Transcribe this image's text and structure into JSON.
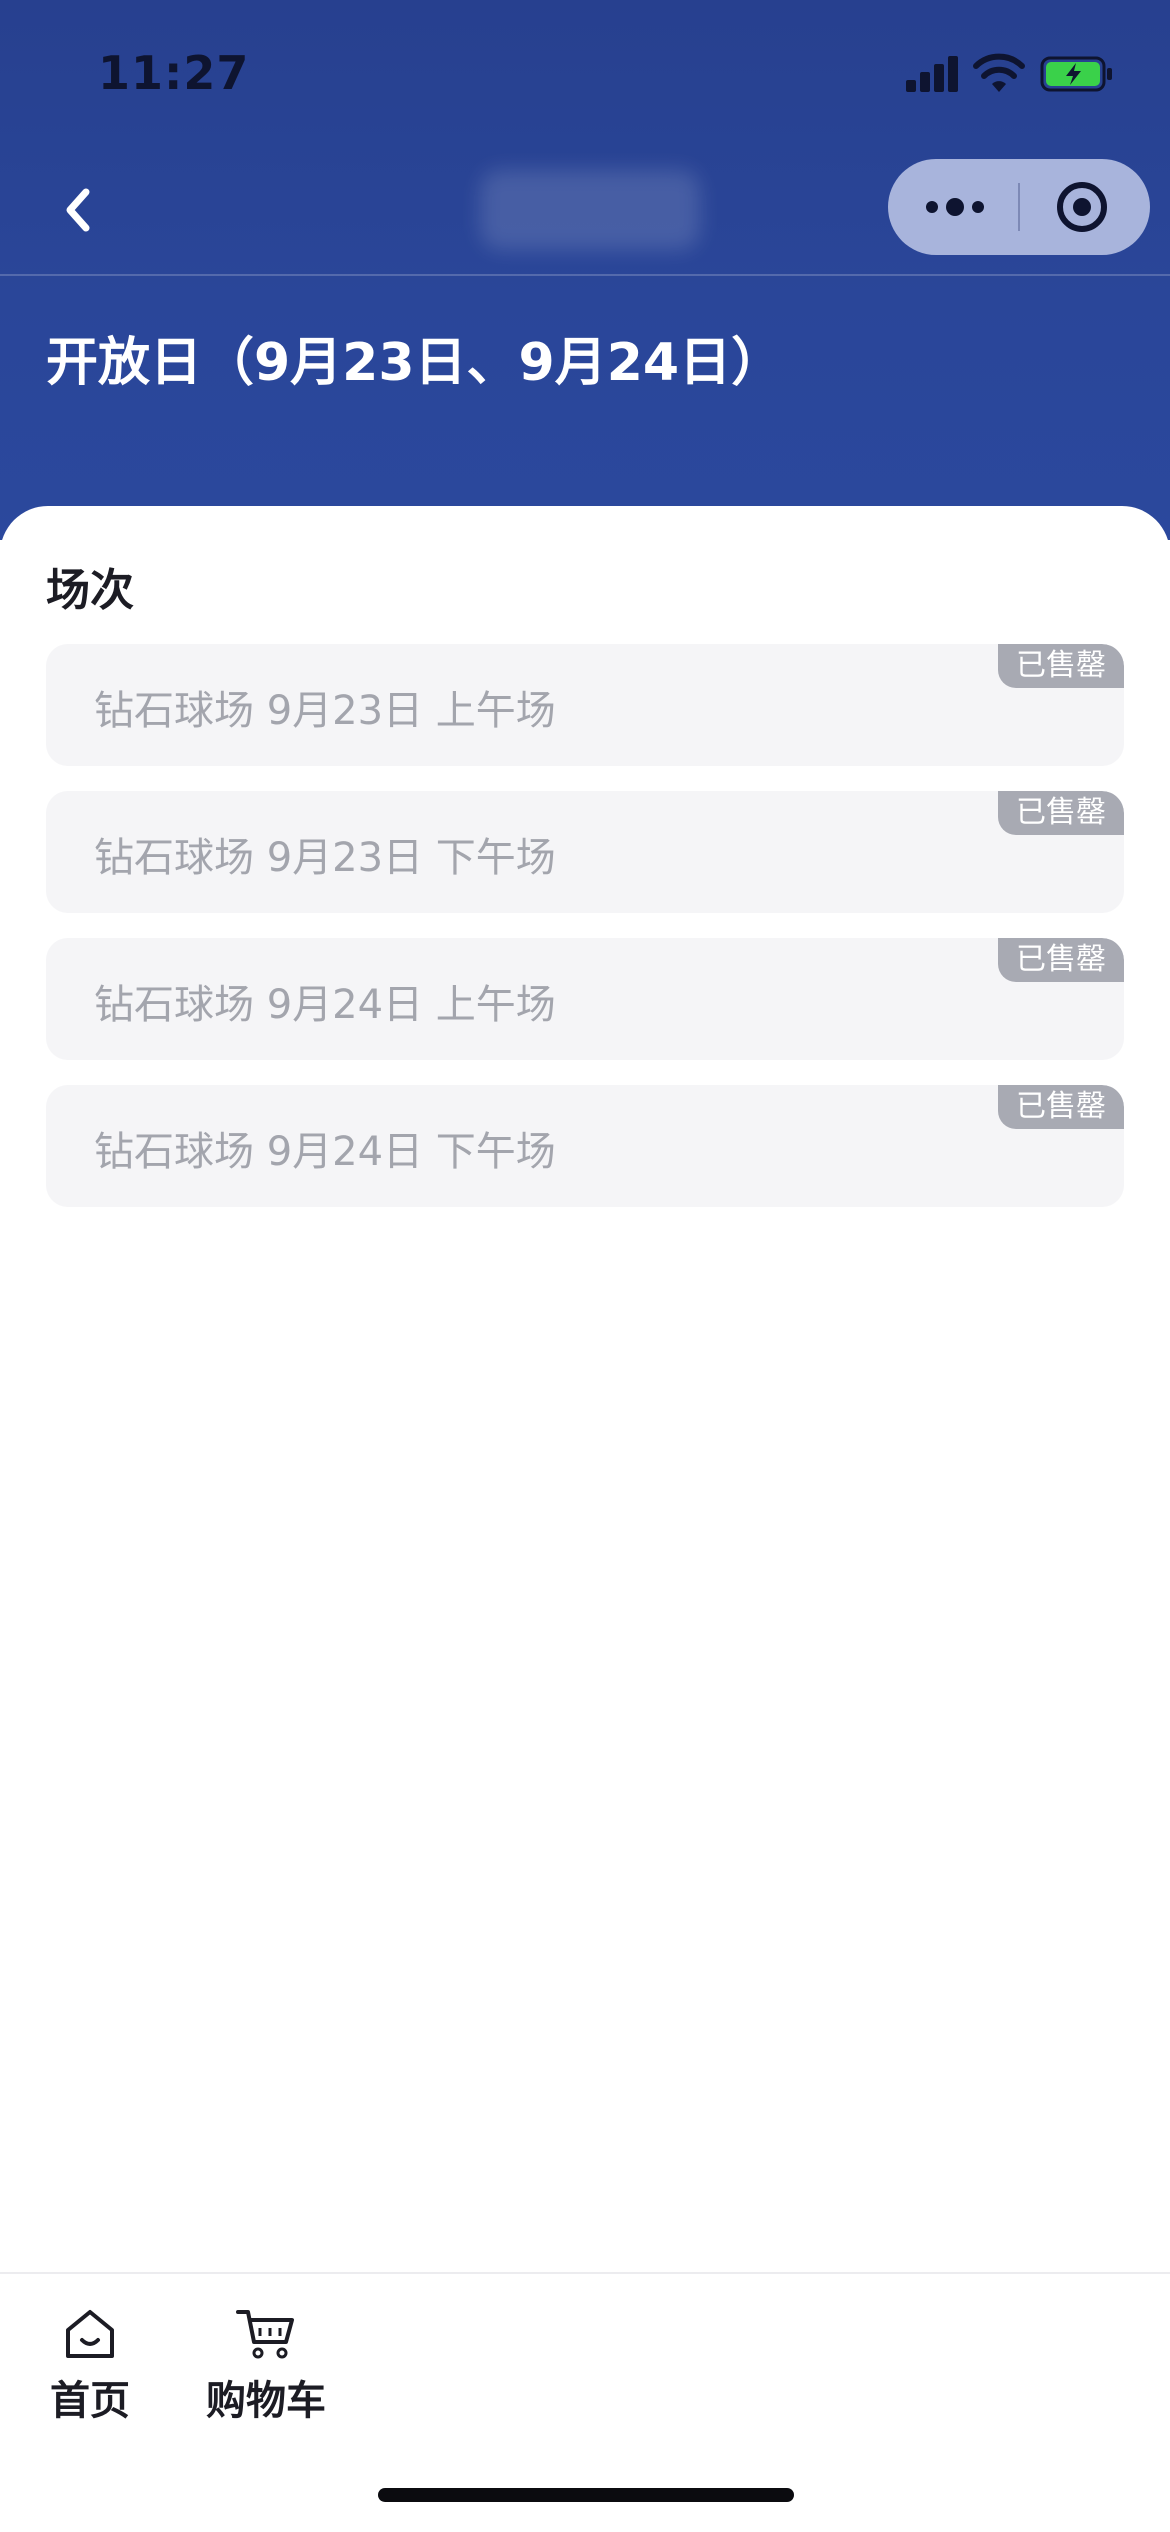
{
  "status_bar": {
    "time": "11:27",
    "signal_icon": "cellular-signal-icon",
    "wifi_icon": "wifi-icon",
    "battery_icon": "battery-charging-icon"
  },
  "nav": {
    "back_icon": "chevron-left-icon",
    "more_icon": "more-dots-icon",
    "close_icon": "target-circle-icon"
  },
  "page_title": "开放日（9月23日、9月24日）",
  "section_title": "场次",
  "sessions": [
    {
      "label": "钻石球场 9月23日 上午场",
      "badge": "已售罄"
    },
    {
      "label": "钻石球场 9月23日 下午场",
      "badge": "已售罄"
    },
    {
      "label": "钻石球场 9月24日 上午场",
      "badge": "已售罄"
    },
    {
      "label": "钻石球场 9月24日 下午场",
      "badge": "已售罄"
    }
  ],
  "tab_bar": {
    "home": {
      "label": "首页",
      "icon": "home-icon"
    },
    "cart": {
      "label": "购物车",
      "icon": "shopping-cart-icon"
    }
  },
  "colors": {
    "header_bg": "#2a4699",
    "capsule_bg": "#a8b4dc",
    "item_bg": "#f5f5f7",
    "item_text": "#a3a5ad",
    "badge_bg": "#a8aab3",
    "battery_green": "#3ad14a"
  }
}
